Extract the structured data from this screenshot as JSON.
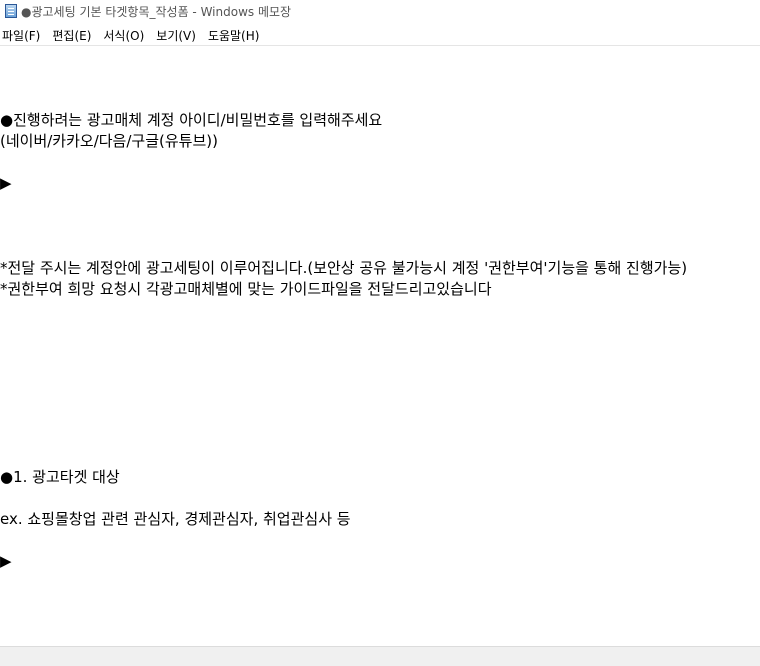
{
  "window": {
    "title": "●광고세팅 기본 타겟항목_작성폼 - Windows 메모장",
    "icon": "notepad-icon"
  },
  "menubar": {
    "items": [
      "파일(F)",
      "편집(E)",
      "서식(O)",
      "보기(V)",
      "도움말(H)"
    ]
  },
  "document": {
    "lines": [
      "●진행하려는 광고매체 계정 아이디/비밀번호를 입력해주세요",
      "(네이버/카카오/다음/구글(유튜브))",
      "▶",
      "*전달 주시는 계정안에 광고세팅이 이루어집니다.(보안상 공유 불가능시 계정 '권한부여'기능을 통해 진행가능)",
      "*권한부여 희망 요청시 각광고매체별에 맞는 가이드파일을 전달드리고있습니다",
      "●1. 광고타겟 대상",
      "ex. 쇼핑몰창업 관련 관심자, 경제관심자, 취업관심사 등",
      "▶"
    ]
  }
}
